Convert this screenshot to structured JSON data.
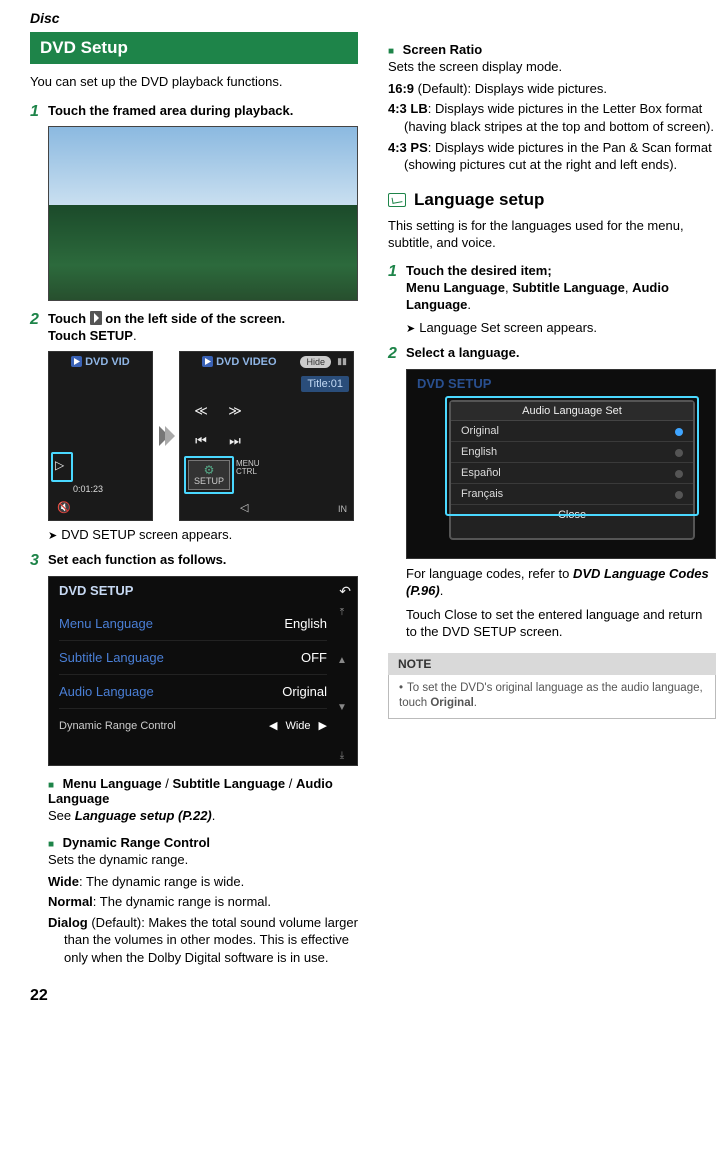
{
  "header": {
    "category": "Disc"
  },
  "section": {
    "title": "DVD Setup",
    "intro": "You can set up the DVD playback functions."
  },
  "steps": {
    "s1": {
      "num": "1",
      "text": "Touch the framed area during playback."
    },
    "s2": {
      "num": "2",
      "pre": "Touch ",
      "mid": " on the left side of the screen.",
      "line2a": "Touch ",
      "btn": "SETUP",
      "line2b": "."
    },
    "s2img": {
      "tagA": "DVD VID",
      "tagB": "DVD VIDEO",
      "hide": "Hide",
      "title": "Title:01",
      "setup": "SETUP",
      "menuctrl": "MENU\nCTRL",
      "timeA": "0:01:23"
    },
    "s2result": "DVD SETUP screen appears.",
    "s3": {
      "num": "3",
      "text": "Set each function as follows."
    },
    "s3img": {
      "title": "DVD SETUP",
      "rows": [
        {
          "k": "Menu Language",
          "v": "English"
        },
        {
          "k": "Subtitle Language",
          "v": "OFF"
        },
        {
          "k": "Audio Language",
          "v": "Original"
        }
      ],
      "dyn": {
        "k": "Dynamic Range Control",
        "v": "Wide"
      }
    }
  },
  "subs": {
    "langs": {
      "a": "Menu Language",
      "b": "Subtitle Language",
      "c": "Audio Language",
      "see": "See ",
      "ref": "Language setup (P.22)",
      "dot": "."
    },
    "drc": {
      "title": "Dynamic Range Control",
      "body": "Sets the dynamic range.",
      "items": [
        {
          "term": "Wide",
          "def": ": The dynamic range is wide."
        },
        {
          "term": "Normal",
          "def": ": The dynamic range is normal."
        },
        {
          "term": "Dialog",
          "def": " (Default): Makes the total sound volume larger than the volumes in other modes. This is effective only when the Dolby Digital software is in use."
        }
      ]
    }
  },
  "right": {
    "sr": {
      "title": "Screen Ratio",
      "body": "Sets the screen display mode.",
      "items": [
        {
          "term": "16:9",
          "def": " (Default): Displays wide pictures."
        },
        {
          "term": "4:3 LB",
          "def": ": Displays wide pictures in the Letter Box format (having black stripes at the top and bottom of screen)."
        },
        {
          "term": "4:3 PS",
          "def": ": Displays wide pictures in the Pan & Scan format (showing pictures cut at the right and left ends)."
        }
      ]
    },
    "lang": {
      "heading": "Language setup",
      "intro": "This setting is for the languages used for the menu, subtitle, and voice.",
      "s1": {
        "num": "1",
        "lead": "Touch the desired item;",
        "a": "Menu Language",
        "b": "Subtitle Language",
        "c": "Audio Language",
        "sep1": ", ",
        "sep2": ", ",
        "dot": "."
      },
      "s1result": "Language Set screen appears.",
      "s2": {
        "num": "2",
        "text": "Select a language."
      },
      "s2img": {
        "bg": "DVD SETUP",
        "pt": "Audio Language Set",
        "opts": [
          "Original",
          "English",
          "Español",
          "Français"
        ],
        "close": "Close"
      },
      "after1a": "For language codes, refer to ",
      "after1ref": "DVD Language Codes (P.96)",
      "after1b": ".",
      "after2": "Touch Close to set the entered language and return to the DVD SETUP screen."
    },
    "note": {
      "head": "NOTE",
      "body_a": "To set the DVD's original language as the audio language, touch ",
      "body_term": "Original",
      "body_b": "."
    }
  },
  "page": "22"
}
